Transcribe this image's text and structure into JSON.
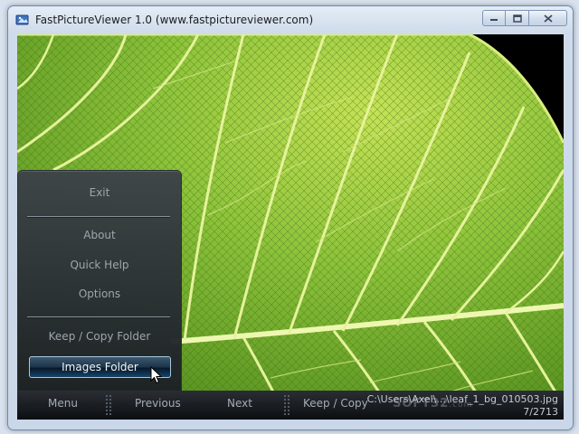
{
  "window": {
    "title": "FastPictureViewer 1.0 (www.fastpictureviewer.com)",
    "controls": {
      "minimize": "minimize-icon",
      "maximize": "maximize-icon",
      "close": "close-icon"
    }
  },
  "menu": {
    "exit": "Exit",
    "about": "About",
    "quick_help": "Quick Help",
    "options": "Options",
    "keep_copy_folder": "Keep / Copy Folder",
    "images_folder": "Images Folder"
  },
  "toolbar": {
    "menu": "Menu",
    "previous": "Previous",
    "next": "Next",
    "keep_copy": "Keep / Copy"
  },
  "status": {
    "file_path": "C:\\Users\\Axel\\...\\leaf_1_bg_010503.jpg",
    "counter": "7/2713"
  },
  "watermark": {
    "main": "SOFT32",
    "suffix": ".com"
  },
  "colors": {
    "leaf_green": "#8fc43a",
    "vein": "#e8f2a8",
    "panel": "#2e343a",
    "active_item": "#1b3448"
  }
}
